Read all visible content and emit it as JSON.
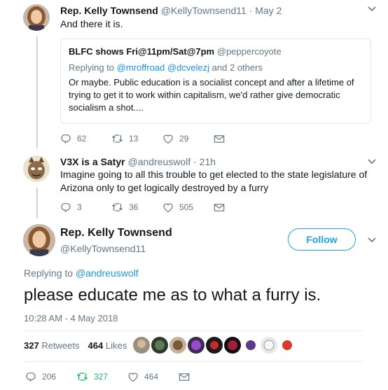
{
  "tweet1": {
    "name": "Rep. Kelly Townsend",
    "handle": "@KellyTownsend11",
    "sep": "·",
    "date": "May 2",
    "text": "And there it is.",
    "quote": {
      "name": "BLFC shows Fri@11pm/Sat@7pm",
      "handle": "@peppercoyote",
      "replying_prefix": "Replying to",
      "replying_to": "@mroffroad @dcvelezj",
      "replying_suffix": "and 2 others",
      "text": "Or maybe. Public education is a socialist concept and after a lifetime of trying to get it to work within capitalism, we'd rather give democratic socialism a shot...."
    },
    "replies": "62",
    "retweets": "13",
    "likes": "29"
  },
  "tweet2": {
    "name": "V3X is a Satyr",
    "handle": "@andreuswolf",
    "sep": "·",
    "date": "21h",
    "text": "Imagine going to all this trouble to get elected to the state legislature of Arizona only to get logically destroyed by a furry",
    "replies": "3",
    "retweets": "36",
    "likes": "505"
  },
  "main": {
    "name": "Rep. Kelly Townsend",
    "handle": "@KellyTownsend11",
    "follow_label": "Follow",
    "replying_prefix": "Replying to",
    "replying_to": "@andreuswolf",
    "text": "please educate me as to what a furry is.",
    "timestamp": "10:28 AM - 4 May 2018",
    "retweet_count": "327",
    "retweet_label": "Retweets",
    "like_count": "464",
    "like_label": "Likes",
    "replies": "206",
    "retweets": "327",
    "likes": "464"
  },
  "colors": {
    "link": "#1b95e0",
    "follow": "#1da1f2",
    "retweet_active": "#17bf63",
    "muted": "#657786"
  },
  "icons": [
    "chevron-down-icon",
    "reply-icon",
    "retweet-icon",
    "heart-icon",
    "mail-icon"
  ]
}
